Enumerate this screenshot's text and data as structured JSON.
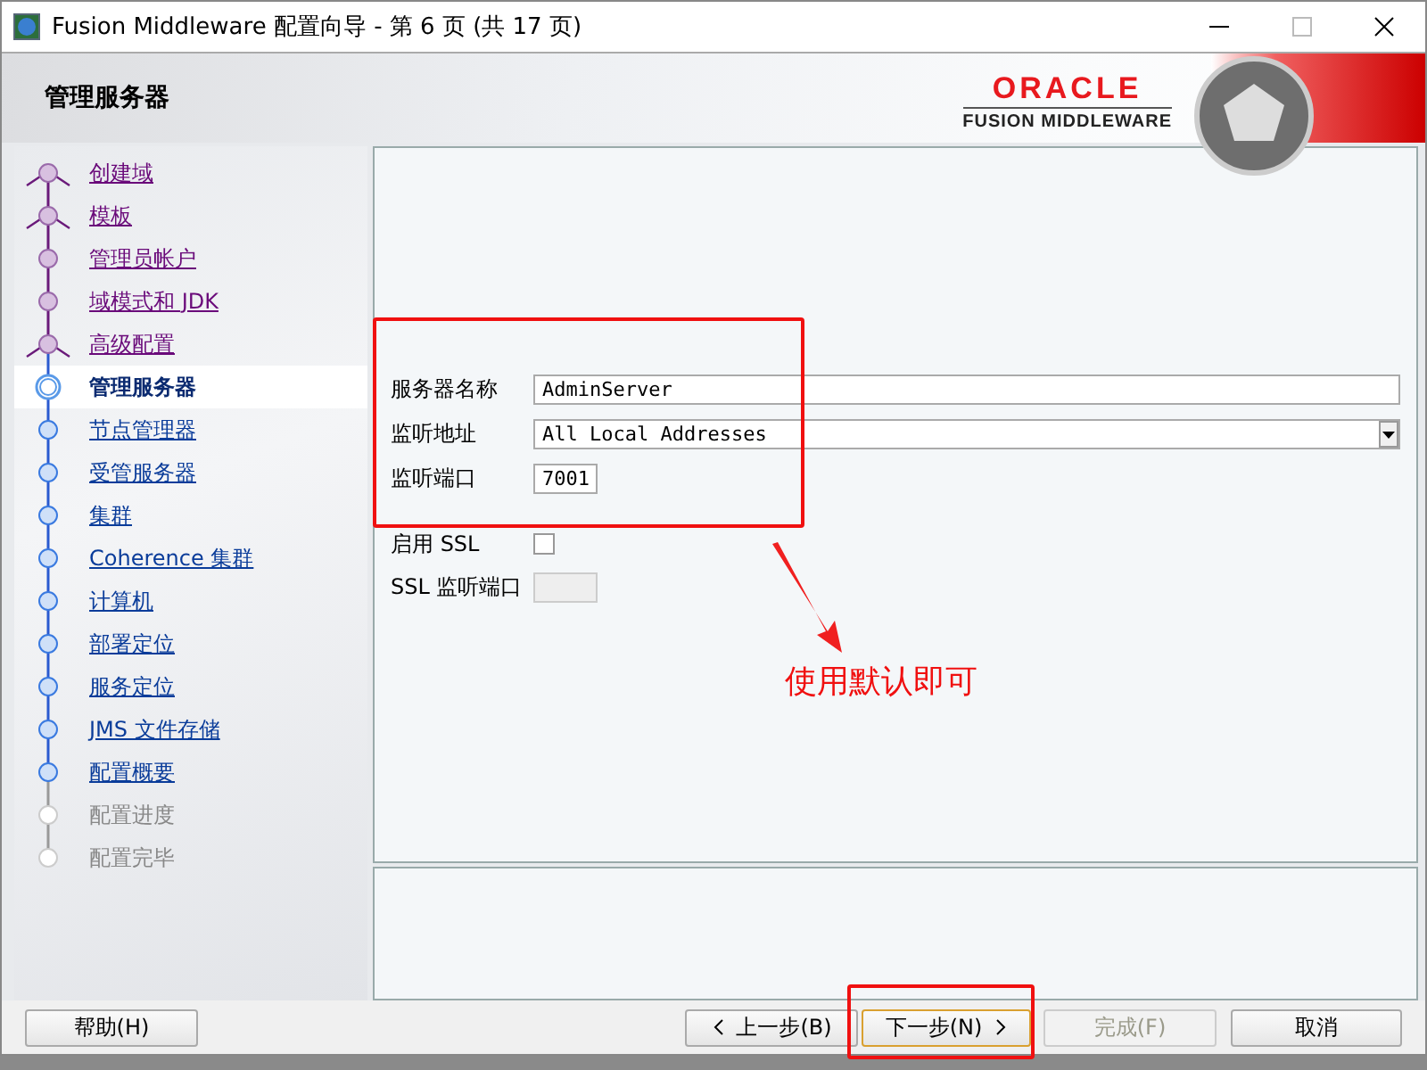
{
  "window": {
    "title": "Fusion Middleware 配置向导 - 第 6 页 (共 17 页)"
  },
  "header": {
    "title": "管理服务器",
    "logo_top": "ORACLE",
    "logo_bottom": "FUSION MIDDLEWARE"
  },
  "steps": [
    {
      "label": "创建域",
      "visited": true,
      "disabled": false,
      "branch": true,
      "selected": false
    },
    {
      "label": "模板",
      "visited": true,
      "disabled": false,
      "branch": true,
      "selected": false
    },
    {
      "label": "管理员帐户",
      "visited": true,
      "disabled": false,
      "branch": false,
      "selected": false
    },
    {
      "label": "域模式和 JDK",
      "visited": true,
      "disabled": false,
      "branch": false,
      "selected": false
    },
    {
      "label": "高级配置",
      "visited": true,
      "disabled": false,
      "branch": true,
      "selected": false
    },
    {
      "label": "管理服务器",
      "visited": false,
      "disabled": false,
      "branch": false,
      "selected": true
    },
    {
      "label": "节点管理器",
      "visited": false,
      "disabled": false,
      "branch": false,
      "selected": false
    },
    {
      "label": "受管服务器",
      "visited": false,
      "disabled": false,
      "branch": false,
      "selected": false
    },
    {
      "label": "集群",
      "visited": false,
      "disabled": false,
      "branch": false,
      "selected": false
    },
    {
      "label": "Coherence 集群",
      "visited": false,
      "disabled": false,
      "branch": false,
      "selected": false
    },
    {
      "label": "计算机",
      "visited": false,
      "disabled": false,
      "branch": false,
      "selected": false
    },
    {
      "label": "部署定位",
      "visited": false,
      "disabled": false,
      "branch": false,
      "selected": false
    },
    {
      "label": "服务定位",
      "visited": false,
      "disabled": false,
      "branch": false,
      "selected": false
    },
    {
      "label": "JMS 文件存储",
      "visited": false,
      "disabled": false,
      "branch": false,
      "selected": false
    },
    {
      "label": "配置概要",
      "visited": false,
      "disabled": false,
      "branch": false,
      "selected": false
    },
    {
      "label": "配置进度",
      "visited": false,
      "disabled": true,
      "branch": false,
      "selected": false
    },
    {
      "label": "配置完毕",
      "visited": false,
      "disabled": true,
      "branch": false,
      "selected": false
    }
  ],
  "form": [
    {
      "kind": "text",
      "label": "服务器名称",
      "value": "AdminServer",
      "wide": true,
      "disabled": false
    },
    {
      "kind": "select",
      "label": "监听地址",
      "value": "All Local Addresses",
      "disabled": false
    },
    {
      "kind": "text",
      "label": "监听端口",
      "value": "7001",
      "wide": false,
      "disabled": false
    },
    {
      "kind": "checkbox",
      "label": "启用 SSL",
      "checked": false,
      "disabled": false
    },
    {
      "kind": "text",
      "label": "SSL 监听端口",
      "wide": false,
      "disabled": true
    }
  ],
  "annotation": {
    "note": "使用默认即可"
  },
  "buttons": [
    {
      "kind": "help",
      "label": "帮助(H)",
      "disabled": false
    },
    {
      "kind": "back",
      "label": "上一步(B)",
      "disabled": false
    },
    {
      "kind": "next",
      "label": "下一步(N)",
      "disabled": false
    },
    {
      "kind": "finish",
      "label": "完成(F)",
      "disabled": true
    },
    {
      "kind": "cancel",
      "label": "取消",
      "disabled": false
    }
  ]
}
